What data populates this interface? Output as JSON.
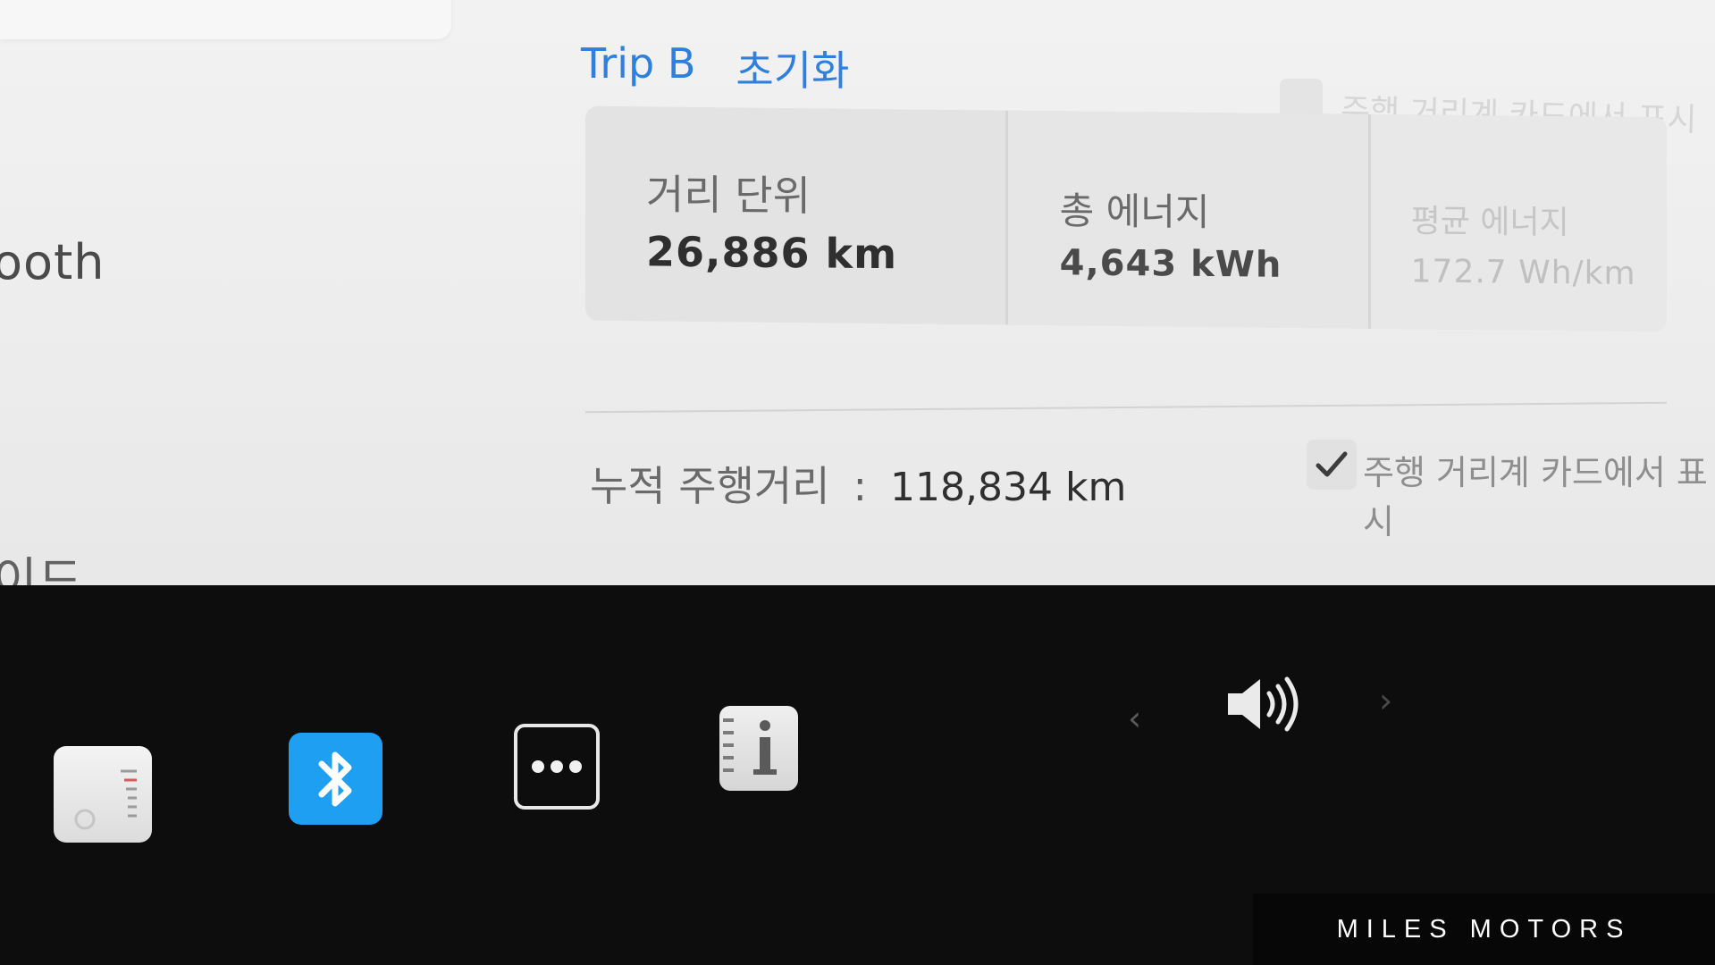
{
  "sidebar": {
    "bluetooth_partial": "ooth",
    "mode_partial": "이드"
  },
  "trip": {
    "name": "Trip B",
    "reset_label": "초기화",
    "show_on_card_label_faded": "주행 거리계 카드에서 표시",
    "stats": [
      {
        "label": "거리 단위",
        "value": "26,886 km"
      },
      {
        "label": "총 에너지",
        "value": "4,643 kWh"
      },
      {
        "label": "평균 에너지",
        "value": "172.7 Wh/km"
      }
    ]
  },
  "odometer": {
    "label": "누적 주행거리",
    "separator": ":",
    "value": "118,834 km",
    "show_on_card_label": "주행 거리계 카드에서 표시",
    "show_on_card_checked": true
  },
  "taskbar": {
    "apps": [
      "energy-meter-icon",
      "bluetooth-icon",
      "more-icon",
      "manual-icon"
    ],
    "nav_prev": "‹",
    "nav_next": "›",
    "volume_icon": "volume-icon"
  },
  "watermark": {
    "text": "MILES MOTORS"
  },
  "colors": {
    "accent_blue": "#2f7fdc",
    "bluetooth_blue": "#1e9ff2",
    "panel_bg": "#ececec",
    "taskbar_bg": "#0d0d0e"
  }
}
